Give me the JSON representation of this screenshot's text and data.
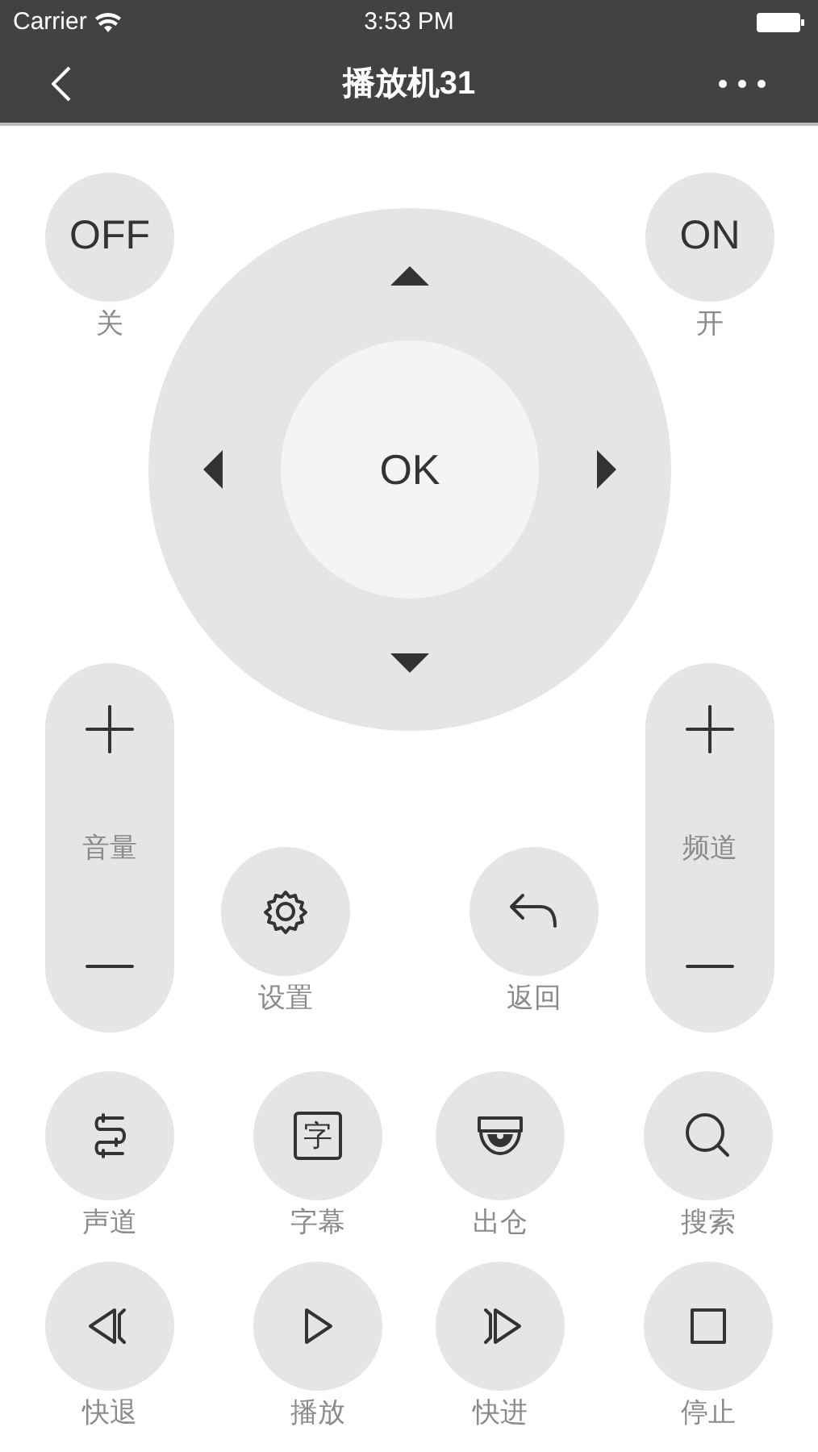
{
  "status_bar": {
    "carrier": "Carrier",
    "time": "3:53 PM"
  },
  "nav": {
    "title": "播放机31"
  },
  "power": [
    {
      "label": "OFF",
      "caption": "关"
    },
    {
      "label": "ON",
      "caption": "开"
    }
  ],
  "dpad": {
    "ok": "OK"
  },
  "rockers": [
    {
      "caption": "音量"
    },
    {
      "caption": "频道"
    }
  ],
  "middle_buttons": [
    {
      "kind": "settings",
      "caption": "设置"
    },
    {
      "kind": "back",
      "caption": "返回"
    }
  ],
  "buttons": [
    {
      "kind": "channel",
      "caption": "声道"
    },
    {
      "kind": "subtitle",
      "glyph": "字",
      "caption": "字幕"
    },
    {
      "kind": "eject",
      "caption": "出仓"
    },
    {
      "kind": "search",
      "caption": "搜索"
    },
    {
      "kind": "rewind",
      "caption": "快退"
    },
    {
      "kind": "play",
      "caption": "播放"
    },
    {
      "kind": "forward",
      "caption": "快进"
    },
    {
      "kind": "stop",
      "caption": "停止"
    }
  ]
}
